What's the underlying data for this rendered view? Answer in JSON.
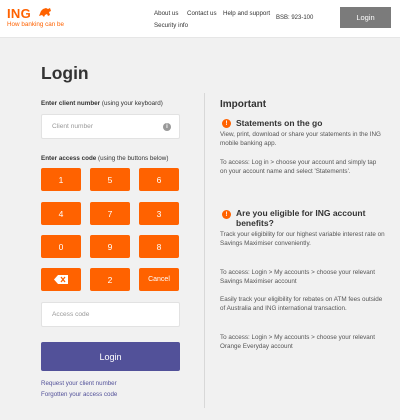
{
  "header": {
    "brand": "ING",
    "tagline": "How banking can be",
    "nav": [
      "About us",
      "Contact us",
      "Help and support",
      "Security info"
    ],
    "bsb": "BSB: 923-100",
    "login_button": "Login"
  },
  "login": {
    "title": "Login",
    "client_label_bold": "Enter client number",
    "client_label_rest": " (using your keyboard)",
    "client_placeholder": "Client number",
    "access_label_bold": "Enter access code",
    "access_label_rest": " (using the buttons below)",
    "keypad": [
      "1",
      "5",
      "6",
      "4",
      "7",
      "3",
      "0",
      "9",
      "8",
      "⌫",
      "2",
      "Cancel"
    ],
    "access_placeholder": "Access code",
    "submit_label": "Login",
    "link_request": "Request your client number",
    "link_forgotten": "Forgotten your access code"
  },
  "important": {
    "title": "Important",
    "section1": {
      "title": "Statements on the go",
      "p1": "View, print, download or share your statements in the ING mobile banking app.",
      "p2": "To access: Log in > choose your account and simply tap on your account name and select 'Statements'."
    },
    "section2": {
      "title": "Are you eligible for ING account benefits?",
      "p1": "Track your eligibility for our highest variable interest rate on Savings Maximiser conveniently.",
      "p2": "To access: Login > My accounts > choose your relevant Savings Maximiser account",
      "p3": "Easily track your eligibility for rebates on ATM fees outside of Australia and ING international transaction.",
      "p4": "To access: Login > My accounts > choose your relevant Orange Everyday account"
    }
  },
  "colors": {
    "brand_orange": "#ff6200",
    "login_purple": "#525199",
    "header_button_grey": "#7b7b7b"
  }
}
